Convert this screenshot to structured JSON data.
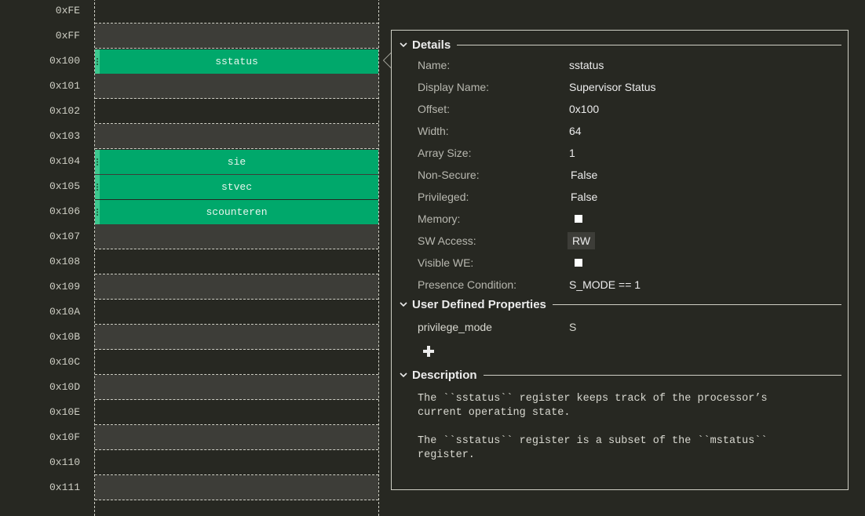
{
  "addresses": [
    "0xFE",
    "0xFF",
    "0x100",
    "0x101",
    "0x102",
    "0x103",
    "0x104",
    "0x105",
    "0x106",
    "0x107",
    "0x108",
    "0x109",
    "0x10A",
    "0x10B",
    "0x10C",
    "0x10D",
    "0x10E",
    "0x10F",
    "0x110",
    "0x111"
  ],
  "registers": [
    {
      "name": "sstatus",
      "address": "0x100"
    },
    {
      "name": "sie",
      "address": "0x104"
    },
    {
      "name": "stvec",
      "address": "0x105"
    },
    {
      "name": "scounteren",
      "address": "0x106"
    }
  ],
  "colors": {
    "register": "#00a86b",
    "background": "#272822",
    "alt_row": "#3d3d38"
  },
  "details": {
    "section_title": "Details",
    "fields": {
      "name": {
        "label": "Name:",
        "value": "sstatus"
      },
      "display_name": {
        "label": "Display Name:",
        "value": "Supervisor Status"
      },
      "offset": {
        "label": "Offset:",
        "value": "0x100"
      },
      "width": {
        "label": "Width:",
        "value": "64"
      },
      "array_size": {
        "label": "Array Size:",
        "value": "1"
      },
      "non_secure": {
        "label": "Non-Secure:",
        "value": "False"
      },
      "privileged": {
        "label": "Privileged:",
        "value": "False"
      },
      "memory": {
        "label": "Memory:",
        "checked": false
      },
      "sw_access": {
        "label": "SW Access:",
        "value": "RW"
      },
      "visible_we": {
        "label": "Visible WE:",
        "checked": false
      },
      "presence_condition": {
        "label": "Presence Condition:",
        "value": "S_MODE == 1"
      }
    }
  },
  "user_defined": {
    "section_title": "User Defined Properties",
    "properties": [
      {
        "key": "privilege_mode",
        "value": "S"
      }
    ],
    "add_icon": "plus-icon"
  },
  "description": {
    "section_title": "Description",
    "paragraphs": [
      "The ``sstatus`` register keeps track of the processor’s\ncurrent operating state.",
      "The ``sstatus`` register is a subset of the ``mstatus``\nregister."
    ]
  }
}
